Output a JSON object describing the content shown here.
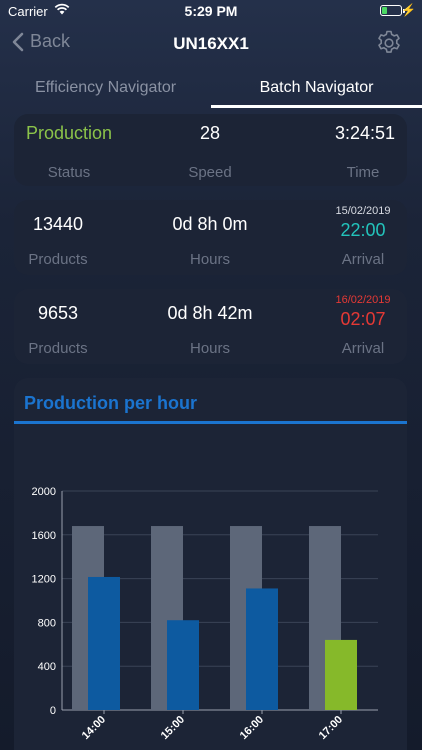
{
  "status_bar": {
    "carrier": "Carrier",
    "time": "5:29 PM"
  },
  "nav": {
    "back_label": "Back",
    "title": "UN16XX1"
  },
  "tabs": [
    {
      "label": "Efficiency Navigator",
      "active": false
    },
    {
      "label": "Batch Navigator",
      "active": true
    }
  ],
  "status_card": {
    "status_value": "Production",
    "status_label": "Status",
    "speed_value": "28",
    "speed_label": "Speed",
    "time_value": "3:24:51",
    "time_label": "Time"
  },
  "batch_cards": [
    {
      "products": "13440",
      "products_label": "Products",
      "hours": "0d 8h 0m",
      "hours_label": "Hours",
      "arrival_date": "15/02/2019",
      "arrival_time": "22:00",
      "arrival_label": "Arrival",
      "arrival_color": "#23c4bc"
    },
    {
      "products": "9653",
      "products_label": "Products",
      "hours": "0d 8h 42m",
      "hours_label": "Hours",
      "arrival_date": "16/02/2019",
      "arrival_time": "02:07",
      "arrival_label": "Arrival",
      "arrival_color": "#e53935"
    }
  ],
  "chart_title": "Production per hour",
  "chart_data": {
    "type": "bar",
    "categories": [
      "14:00",
      "15:00",
      "16:00",
      "17:00"
    ],
    "series": [
      {
        "values": [
          1680,
          1680,
          1680,
          1680
        ],
        "color": "#5d6779"
      },
      {
        "values": [
          1215,
          820,
          1110,
          640
        ],
        "colors": [
          "#0d5aa0",
          "#0d5aa0",
          "#0d5aa0",
          "#86b92a"
        ]
      }
    ],
    "ylim": [
      0,
      2000
    ],
    "yticks": [
      0,
      400,
      800,
      1200,
      1600,
      2000
    ],
    "grid": true
  }
}
